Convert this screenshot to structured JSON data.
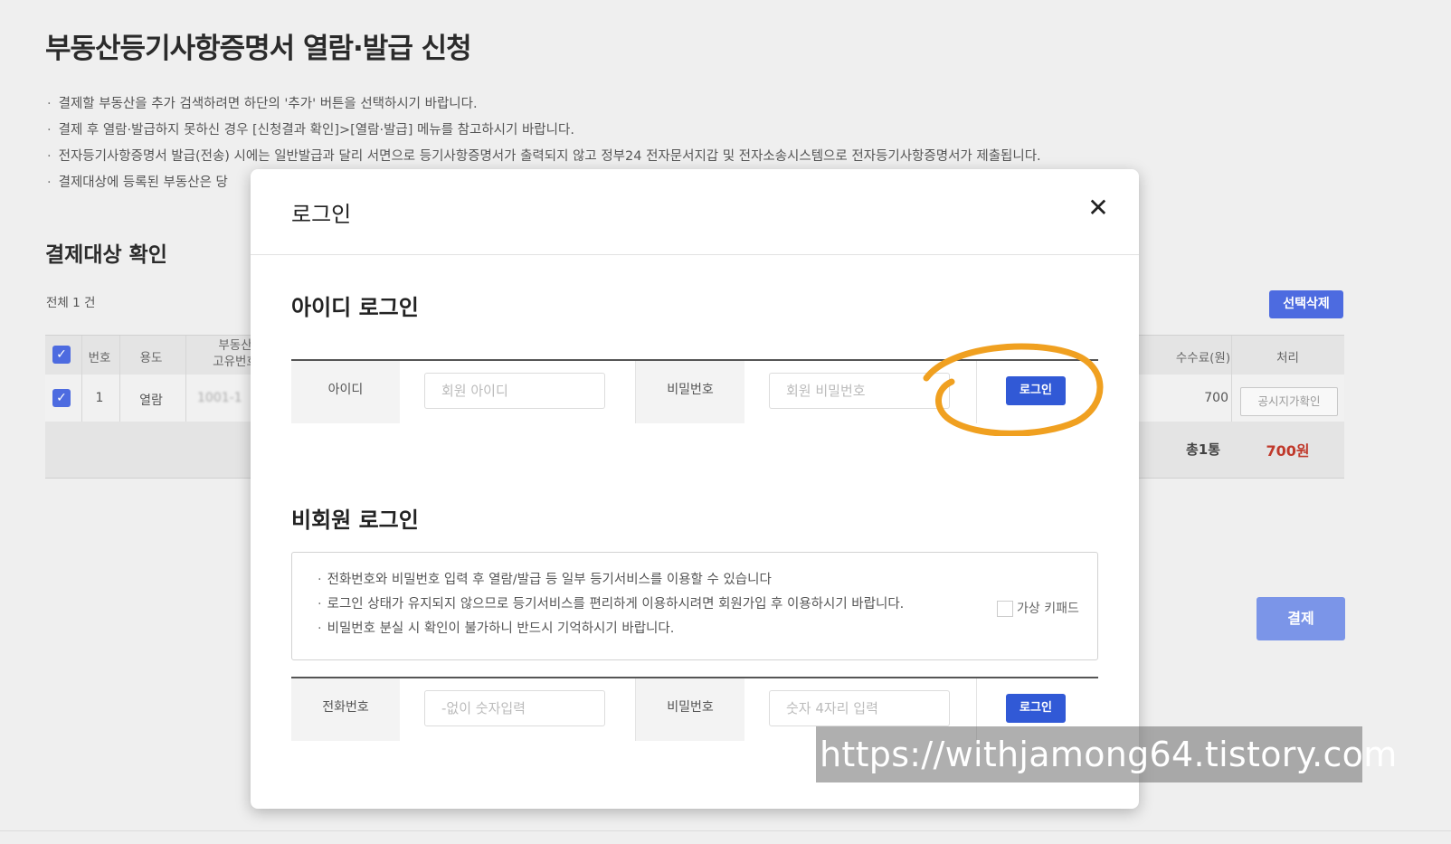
{
  "page": {
    "title": "부동산등기사항증명서 열람·발급 신청",
    "notices": [
      "결제할 부동산을 추가 검색하려면 하단의 '추가' 버튼을 선택하시기 바랍니다.",
      "결제 후 열람·발급하지 못하신 경우 [신청결과 확인]>[열람·발급] 메뉴를 참고하시기 바랍니다.",
      "전자등기사항증명서 발급(전송) 시에는 일반발급과 달리 서면으로 등기사항증명서가 출력되지 않고 정부24 전자문서지갑 및 전자소송시스템으로 전자등기사항증명서가 제출됩니다.",
      "결제대상에 등록된 부동산은 당"
    ],
    "section_title": "결제대상 확인",
    "total_count": "전체 1 건",
    "delete_selected_label": "선택삭제",
    "table": {
      "headers": {
        "number": "번호",
        "usage": "용도",
        "unique_number_line1": "부동산",
        "unique_number_line2": "고유번호",
        "fee": "수수료(원)",
        "action": "처리"
      },
      "row": {
        "number": "1",
        "usage": "열람",
        "unique_number": "1001-1",
        "fee": "700",
        "action_label": "공시지가확인"
      },
      "footer": {
        "total_count": "총1통",
        "total_amount": "700원"
      }
    },
    "pay_label": "결제",
    "check_mark": "✓"
  },
  "modal": {
    "title": "로그인",
    "close_symbol": "✕",
    "id_login": {
      "title": "아이디 로그인",
      "id_label": "아이디",
      "id_placeholder": "회원 아이디",
      "password_label": "비밀번호",
      "password_placeholder": "회원 비밀번호",
      "login_label": "로그인",
      "keypad_label": "가상 키패드"
    },
    "guest_login": {
      "title": "비회원 로그인",
      "notices": [
        "전화번호와 비밀번호 입력 후 열람/발급 등 일부 등기서비스를 이용할 수 있습니다",
        "로그인 상태가 유지되지 않으므로 등기서비스를 편리하게 이용하시려면 회원가입 후 이용하시기 바랍니다.",
        "비밀번호 분실 시 확인이 불가하니 반드시 기억하시기 바랍니다."
      ],
      "phone_label": "전화번호",
      "phone_placeholder": "-없이 숫자입력",
      "password_label": "비밀번호",
      "password_placeholder": "숫자 4자리 입력",
      "login_label": "로그인"
    }
  },
  "annotation": {
    "watermark": "https://withjamong64.tistory.com",
    "circle_color": "#f0a020"
  },
  "colors": {
    "accent": "#3159d6",
    "button_blue": "#4d6be0",
    "pay_button": "#7b95e8",
    "total_red": "#c0392b"
  }
}
